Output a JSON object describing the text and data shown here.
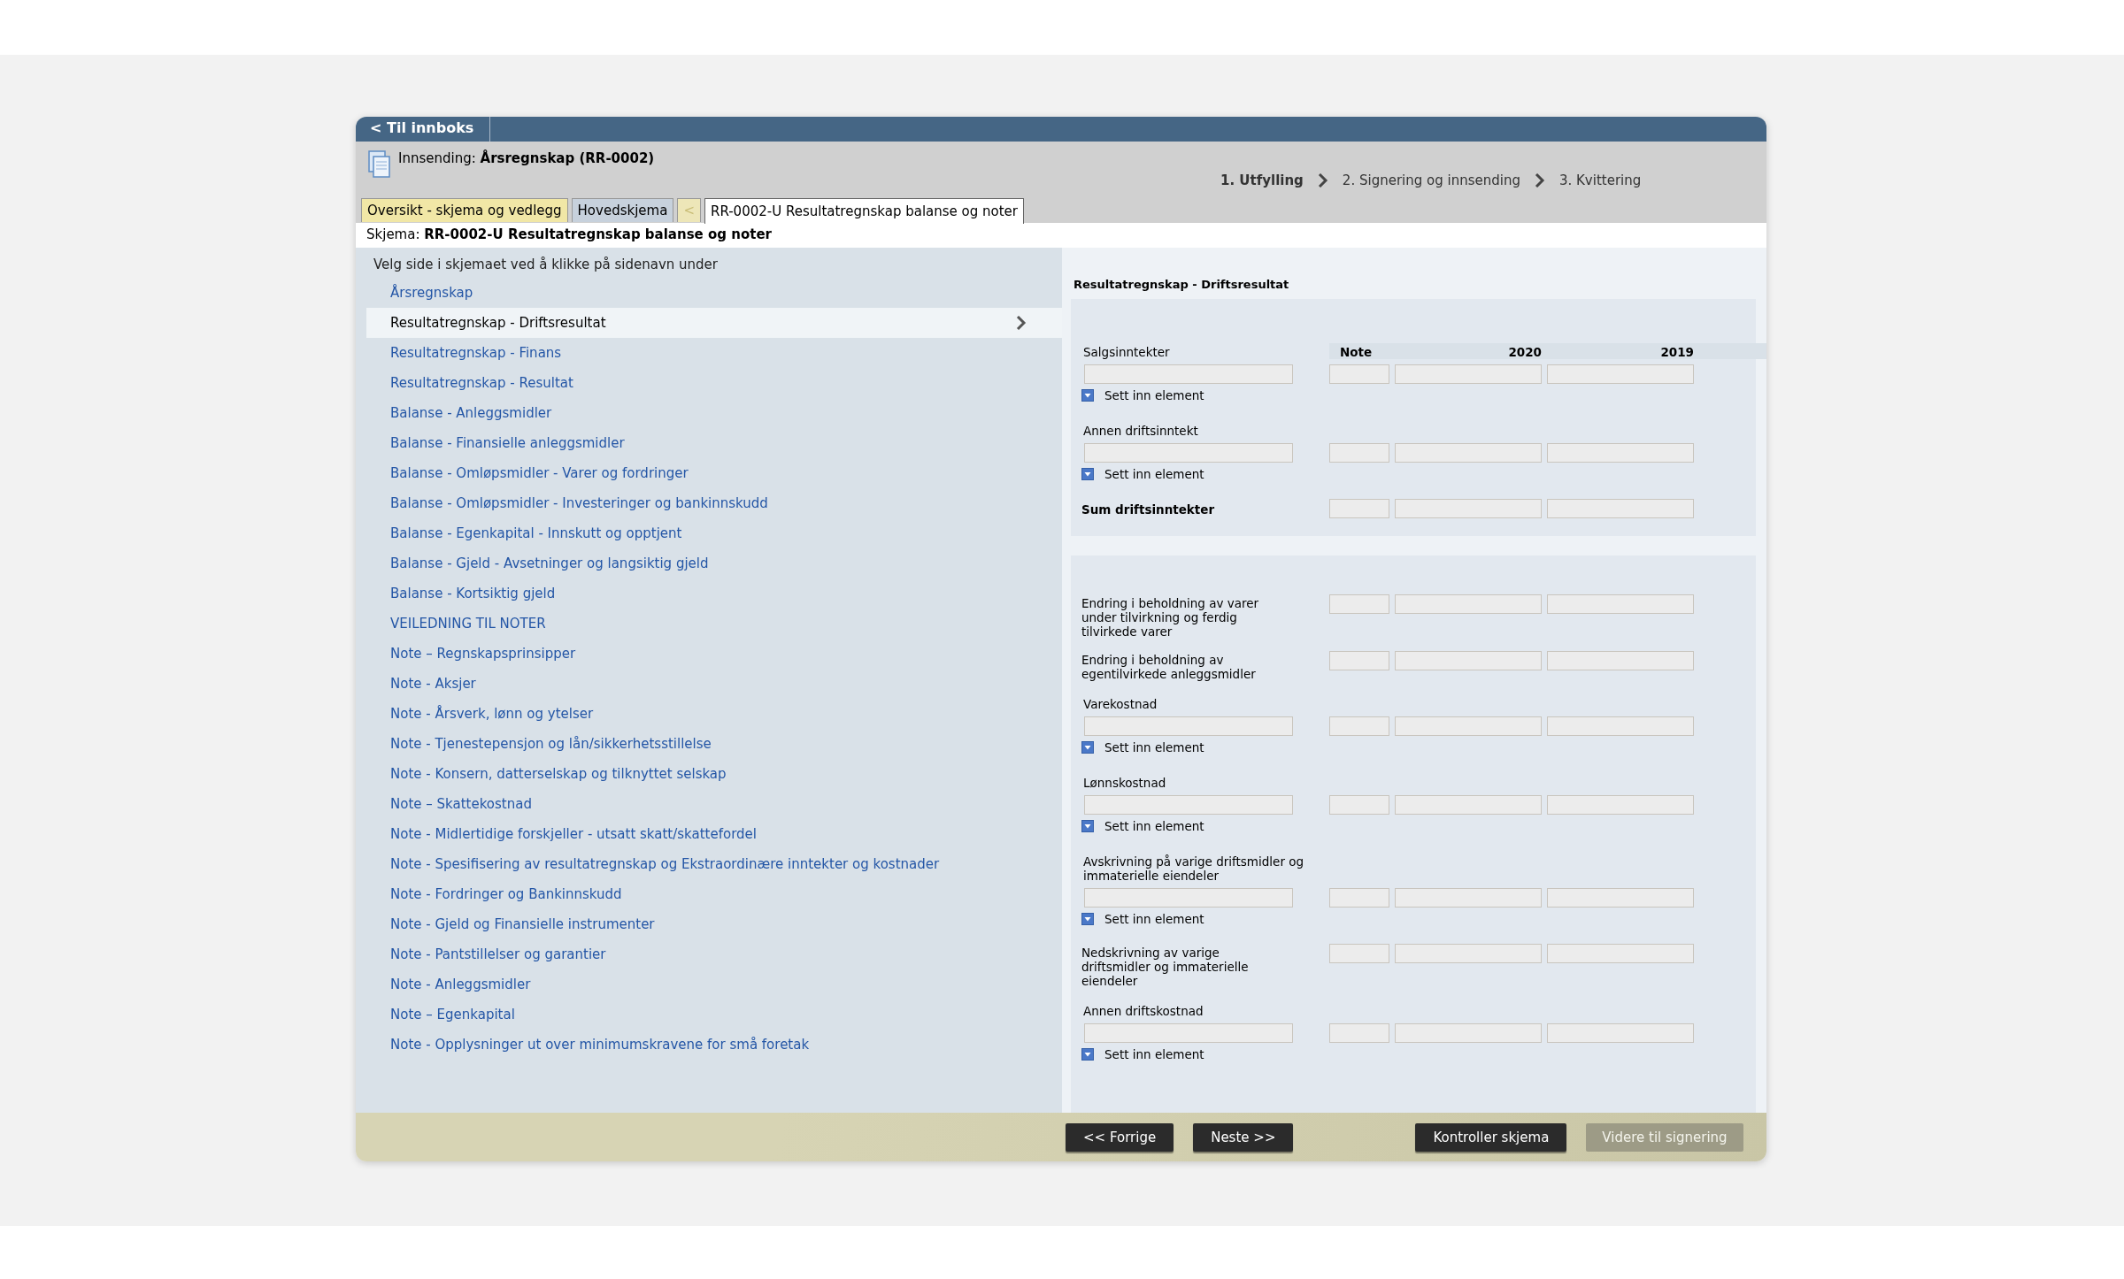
{
  "nav_back": "< Til innboks",
  "submission": "Innsending: **Årsregnskap (RR-0002)**",
  "steps": [
    {
      "label": "1. Utfylling",
      "selected": true
    },
    {
      "label": "2. Signering og innsending",
      "selected": false
    },
    {
      "label": "3. Kvittering",
      "selected": false
    }
  ],
  "tabs": [
    {
      "label": "Oversikt - skjema og vedlegg",
      "kind": "overview",
      "selected": false
    },
    {
      "label": "Hovedskjema",
      "kind": "main",
      "selected": false
    },
    {
      "label": "<",
      "kind": "arrow",
      "selected": false
    },
    {
      "label": "RR-0002-U Resultatregnskap balanse og noter",
      "kind": "form",
      "selected": true
    }
  ],
  "form_name": "Skjema: **RR-0002-U Resultatregnskap balanse og noter**",
  "page_nav": {
    "hint": "Velg side i skjemaet ved å klikke på sidenavn under",
    "items": [
      {
        "label": "Årsregnskap",
        "selected": false
      },
      {
        "label": "Resultatregnskap - Driftsresultat",
        "selected": true
      },
      {
        "label": "Resultatregnskap - Finans",
        "selected": false
      },
      {
        "label": "Resultatregnskap - Resultat",
        "selected": false
      },
      {
        "label": "Balanse - Anleggsmidler",
        "selected": false
      },
      {
        "label": "Balanse - Finansielle anleggsmidler",
        "selected": false
      },
      {
        "label": "Balanse - Omløpsmidler - Varer og fordringer",
        "selected": false
      },
      {
        "label": "Balanse - Omløpsmidler - Investeringer og bankinnskudd",
        "selected": false
      },
      {
        "label": "Balanse - Egenkapital - Innskutt og opptjent",
        "selected": false
      },
      {
        "label": "Balanse - Gjeld - Avsetninger og langsiktig gjeld",
        "selected": false
      },
      {
        "label": "Balanse - Kortsiktig gjeld",
        "selected": false
      },
      {
        "label": "VEILEDNING TIL NOTER",
        "selected": false
      },
      {
        "label": "Note – Regnskapsprinsipper",
        "selected": false
      },
      {
        "label": "Note - Aksjer",
        "selected": false
      },
      {
        "label": "Note - Årsverk, lønn og ytelser",
        "selected": false
      },
      {
        "label": "Note - Tjenestepensjon og lån/sikkerhetsstillelse",
        "selected": false
      },
      {
        "label": "Note - Konsern, datterselskap og tilknyttet selskap",
        "selected": false
      },
      {
        "label": "Note – Skattekostnad",
        "selected": false
      },
      {
        "label": "Note - Midlertidige forskjeller - utsatt skatt/skattefordel",
        "selected": false
      },
      {
        "label": "Note - Spesifisering av resultatregnskap og Ekstraordinære inntekter og kostnader",
        "selected": false
      },
      {
        "label": "Note - Fordringer og Bankinnskudd",
        "selected": false
      },
      {
        "label": "Note - Gjeld og Finansielle instrumenter",
        "selected": false
      },
      {
        "label": "Note - Pantstillelser og garantier",
        "selected": false
      },
      {
        "label": "Note - Anleggsmidler",
        "selected": false
      },
      {
        "label": "Note – Egenkapital",
        "selected": false
      },
      {
        "label": "Note - Opplysninger ut over minimumskravene for små foretak",
        "selected": false
      }
    ]
  },
  "page_title": "Resultatregnskap - Driftsresultat",
  "columns": [
    "Note",
    "2020",
    "2019"
  ],
  "sections": [
    {
      "rows": [
        {
          "kind": "entry",
          "label": "Salgsinntekter",
          "action": "Sett inn element"
        },
        {
          "kind": "entry",
          "label": "Annen driftsinntekt",
          "action": "Sett inn element"
        },
        {
          "kind": "sum",
          "label": "Sum driftsinntekter"
        }
      ]
    },
    {
      "rows": [
        {
          "kind": "fixed",
          "label": "Endring i beholdning av varer under tilvirkning og ferdig tilvirkede varer"
        },
        {
          "kind": "fixed",
          "label": "Endring i beholdning av egentilvirkede anleggsmidler"
        },
        {
          "kind": "entry",
          "label": "Varekostnad",
          "action": "Sett inn element"
        },
        {
          "kind": "entry",
          "label": "Lønnskostnad",
          "action": "Sett inn element"
        },
        {
          "kind": "entry",
          "label": "Avskrivning på varige driftsmidler og immaterielle eiendeler",
          "action": "Sett inn element"
        },
        {
          "kind": "fixed",
          "label": "Nedskrivning av varige driftsmidler og immaterielle eiendeler"
        },
        {
          "kind": "entry",
          "label": "Annen driftskostnad",
          "action": "Sett inn element"
        }
      ]
    }
  ],
  "buttons": [
    {
      "label": "<< Forrige",
      "disabled": false
    },
    {
      "label": "Neste >>",
      "disabled": false
    },
    {
      "label": "Kontroller skjema",
      "disabled": false
    },
    {
      "label": "Videre til signering",
      "disabled": true
    }
  ]
}
